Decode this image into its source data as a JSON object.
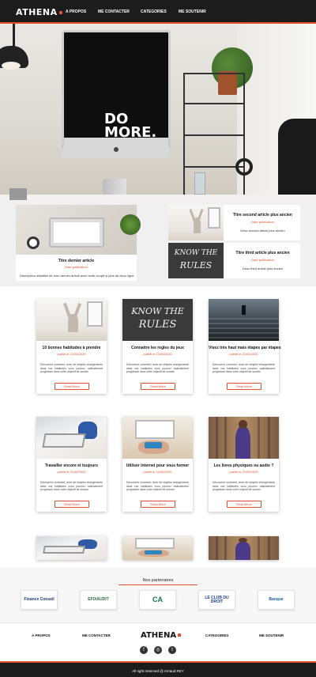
{
  "header": {
    "logo": "ATHENA",
    "nav": [
      "A PROPOS",
      "ME CONTACTER",
      "CATEGORIES",
      "ME SOUTENIR"
    ]
  },
  "hero": {
    "screen_text_1": "DO",
    "screen_text_2": "MORE."
  },
  "featured": {
    "main": {
      "title": "Titre dernier article",
      "sub": "Date publication",
      "desc": "Description détaillée de mon dernier article avec texte coupé si plus de deux ligne"
    },
    "second": {
      "title": "Titre second article plus ancien",
      "sub": "Date publication",
      "desc": "Desc second article plus ancien"
    },
    "third": {
      "title": "Titre third article plus ancien",
      "sub": "Date publication",
      "desc": "Desc third article plus ancien",
      "image_text_1": "KNOW THE",
      "image_text_2": "RULES"
    }
  },
  "articles": [
    {
      "title": "10 bonnes habitudes à prendre",
      "date": "publié le 21/05/2020",
      "text": "Découvrez comment, avec de simples changements dans vos habitudes vous pourrez radicalement progresser dans votre objectif de succès",
      "button": "Read More"
    },
    {
      "title": "Connaitre les regles du jeux",
      "date": "publié le 21/05/2020",
      "text": "Découvrez comment, avec de simples changements dans vos habitudes vous pourrez radicalement progresser dans votre objectif de succès",
      "button": "Read More",
      "image_text_1": "KNOW THE",
      "image_text_2": "RULES"
    },
    {
      "title": "Visez très haut mais étapes par étapes",
      "date": "publié le 21/05/2020",
      "text": "Découvrez comment, avec de simples changements dans vos habitudes vous pourrez radicalement progresser dans votre objectif de succès",
      "button": "Read More"
    },
    {
      "title": "Travailler encore et toujours",
      "date": "publié le 21/05/2020",
      "text": "Découvrez comment, avec de simples changements dans vos habitudes vous pourrez radicalement progresser dans votre objectif de succès",
      "button": "Read More"
    },
    {
      "title": "Utiliser internet pour vous former",
      "date": "publié le 21/05/2020",
      "text": "Découvrez comment, avec de simples changements dans vos habitudes vous pourrez radicalement progresser dans votre objectif de succès",
      "button": "Read More"
    },
    {
      "title": "Les livres physiques ou audio ?",
      "date": "publié le 21/05/2020",
      "text": "Découvrez comment, avec de simples changements dans vos habitudes vous pourrez radicalement progresser dans votre objectif de succès",
      "button": "Read More"
    }
  ],
  "partners": {
    "title": "Nos partenaires",
    "logos": [
      "Finance Conseil",
      "EFIXAUDIT",
      "CA",
      "LE CLUB DU DROIT",
      "Banque"
    ]
  },
  "footer": {
    "nav_left": [
      "A PROPOS",
      "ME CONTACTER"
    ],
    "logo": "ATHENA",
    "nav_right": [
      "CATEGORIES",
      "ME SOUTENIR"
    ],
    "social": [
      "facebook-icon",
      "instagram-icon",
      "twitter-icon"
    ],
    "copyright": "All right reserved @ Arnaud REY"
  },
  "colors": {
    "accent": "#e04e2b",
    "dark": "#1c1c1c"
  }
}
